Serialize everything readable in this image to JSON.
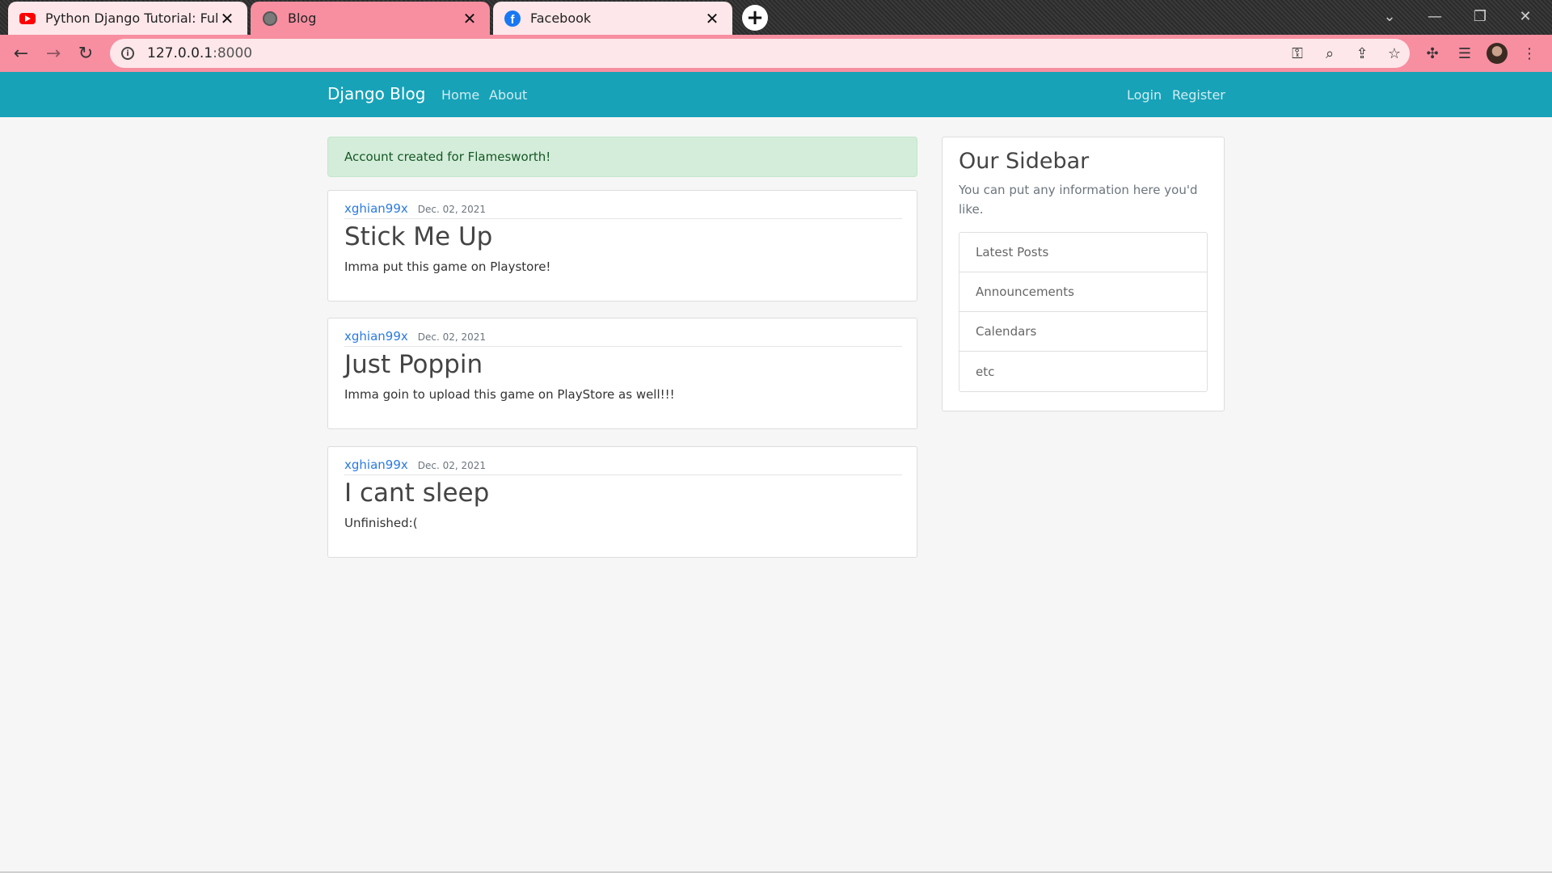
{
  "browser": {
    "tabs": [
      {
        "title": "Python Django Tutorial: Full-Feat",
        "icon": "youtube-icon"
      },
      {
        "title": "Blog",
        "icon": "globe-icon"
      },
      {
        "title": "Facebook",
        "icon": "facebook-icon"
      }
    ],
    "close_glyph": "✕",
    "new_tab_glyph": "+",
    "address": {
      "host": "127.0.0.1",
      "port": ":8000"
    }
  },
  "site": {
    "brand": "Django Blog",
    "nav_left": [
      "Home",
      "About"
    ],
    "nav_right": [
      "Login",
      "Register"
    ],
    "nav_color": "#17a2b8"
  },
  "alert": {
    "message": "Account created for Flamesworth!"
  },
  "posts": [
    {
      "author": "xghian99x",
      "date": "Dec. 02, 2021",
      "title": "Stick Me Up",
      "content": "Imma put this game on Playstore!"
    },
    {
      "author": "xghian99x",
      "date": "Dec. 02, 2021",
      "title": "Just Poppin",
      "content": "Imma goin to upload this game on PlayStore as well!!!"
    },
    {
      "author": "xghian99x",
      "date": "Dec. 02, 2021",
      "title": "I cant sleep",
      "content": "Unfinished:("
    }
  ],
  "sidebar": {
    "title": "Our Sidebar",
    "text": "You can put any information here you'd like.",
    "items": [
      "Latest Posts",
      "Announcements",
      "Calendars",
      "etc"
    ]
  }
}
